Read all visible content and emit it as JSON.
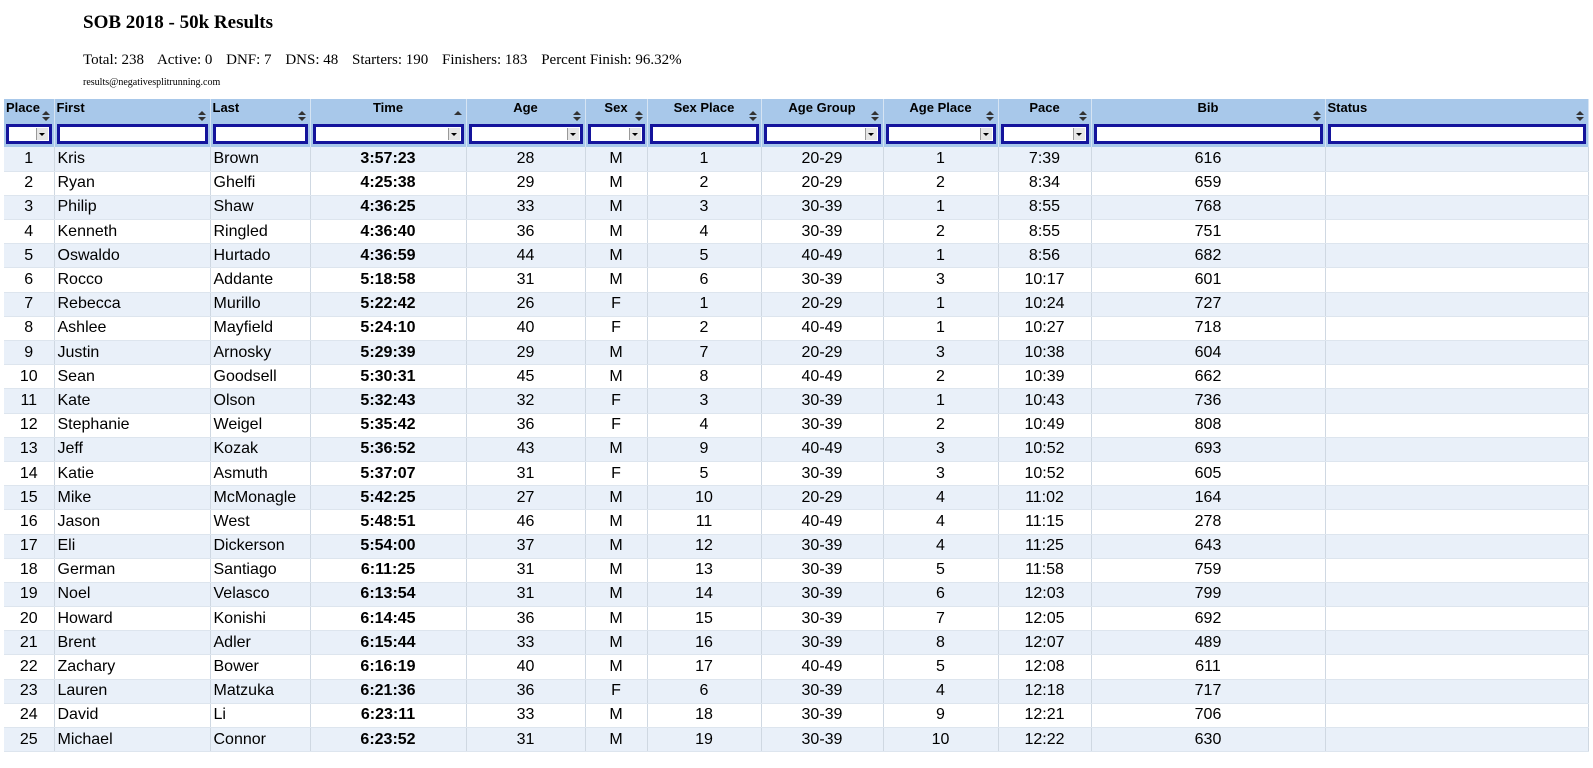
{
  "title": "SOB 2018 - 50k Results",
  "summary": {
    "total": "Total: 238",
    "active": "Active: 0",
    "dnf": "DNF: 7",
    "dns": "DNS: 48",
    "starters": "Starters: 190",
    "finishers": "Finishers: 183",
    "percent": "Percent Finish: 96.32%"
  },
  "contact": "results@negativesplitrunning.com",
  "columns": [
    "Place",
    "First",
    "Last",
    "Time",
    "Age",
    "Sex",
    "Sex Place",
    "Age Group",
    "Age Place",
    "Pace",
    "Bib",
    "Status"
  ],
  "rows": [
    [
      "1",
      "Kris",
      "Brown",
      "3:57:23",
      "28",
      "M",
      "1",
      "20-29",
      "1",
      "7:39",
      "616",
      ""
    ],
    [
      "2",
      "Ryan",
      "Ghelfi",
      "4:25:38",
      "29",
      "M",
      "2",
      "20-29",
      "2",
      "8:34",
      "659",
      ""
    ],
    [
      "3",
      "Philip",
      "Shaw",
      "4:36:25",
      "33",
      "M",
      "3",
      "30-39",
      "1",
      "8:55",
      "768",
      ""
    ],
    [
      "4",
      "Kenneth",
      "Ringled",
      "4:36:40",
      "36",
      "M",
      "4",
      "30-39",
      "2",
      "8:55",
      "751",
      ""
    ],
    [
      "5",
      "Oswaldo",
      "Hurtado",
      "4:36:59",
      "44",
      "M",
      "5",
      "40-49",
      "1",
      "8:56",
      "682",
      ""
    ],
    [
      "6",
      "Rocco",
      "Addante",
      "5:18:58",
      "31",
      "M",
      "6",
      "30-39",
      "3",
      "10:17",
      "601",
      ""
    ],
    [
      "7",
      "Rebecca",
      "Murillo",
      "5:22:42",
      "26",
      "F",
      "1",
      "20-29",
      "1",
      "10:24",
      "727",
      ""
    ],
    [
      "8",
      "Ashlee",
      "Mayfield",
      "5:24:10",
      "40",
      "F",
      "2",
      "40-49",
      "1",
      "10:27",
      "718",
      ""
    ],
    [
      "9",
      "Justin",
      "Arnosky",
      "5:29:39",
      "29",
      "M",
      "7",
      "20-29",
      "3",
      "10:38",
      "604",
      ""
    ],
    [
      "10",
      "Sean",
      "Goodsell",
      "5:30:31",
      "45",
      "M",
      "8",
      "40-49",
      "2",
      "10:39",
      "662",
      ""
    ],
    [
      "11",
      "Kate",
      "Olson",
      "5:32:43",
      "32",
      "F",
      "3",
      "30-39",
      "1",
      "10:43",
      "736",
      ""
    ],
    [
      "12",
      "Stephanie",
      "Weigel",
      "5:35:42",
      "36",
      "F",
      "4",
      "30-39",
      "2",
      "10:49",
      "808",
      ""
    ],
    [
      "13",
      "Jeff",
      "Kozak",
      "5:36:52",
      "43",
      "M",
      "9",
      "40-49",
      "3",
      "10:52",
      "693",
      ""
    ],
    [
      "14",
      "Katie",
      "Asmuth",
      "5:37:07",
      "31",
      "F",
      "5",
      "30-39",
      "3",
      "10:52",
      "605",
      ""
    ],
    [
      "15",
      "Mike",
      "McMonagle",
      "5:42:25",
      "27",
      "M",
      "10",
      "20-29",
      "4",
      "11:02",
      "164",
      ""
    ],
    [
      "16",
      "Jason",
      "West",
      "5:48:51",
      "46",
      "M",
      "11",
      "40-49",
      "4",
      "11:15",
      "278",
      ""
    ],
    [
      "17",
      "Eli",
      "Dickerson",
      "5:54:00",
      "37",
      "M",
      "12",
      "30-39",
      "4",
      "11:25",
      "643",
      ""
    ],
    [
      "18",
      "German",
      "Santiago",
      "6:11:25",
      "31",
      "M",
      "13",
      "30-39",
      "5",
      "11:58",
      "759",
      ""
    ],
    [
      "19",
      "Noel",
      "Velasco",
      "6:13:54",
      "31",
      "M",
      "14",
      "30-39",
      "6",
      "12:03",
      "799",
      ""
    ],
    [
      "20",
      "Howard",
      "Konishi",
      "6:14:45",
      "36",
      "M",
      "15",
      "30-39",
      "7",
      "12:05",
      "692",
      ""
    ],
    [
      "21",
      "Brent",
      "Adler",
      "6:15:44",
      "33",
      "M",
      "16",
      "30-39",
      "8",
      "12:07",
      "489",
      ""
    ],
    [
      "22",
      "Zachary",
      "Bower",
      "6:16:19",
      "40",
      "M",
      "17",
      "40-49",
      "5",
      "12:08",
      "611",
      ""
    ],
    [
      "23",
      "Lauren",
      "Matzuka",
      "6:21:36",
      "36",
      "F",
      "6",
      "30-39",
      "4",
      "12:18",
      "717",
      ""
    ],
    [
      "24",
      "David",
      "Li",
      "6:23:11",
      "33",
      "M",
      "18",
      "30-39",
      "9",
      "12:21",
      "706",
      ""
    ],
    [
      "25",
      "Michael",
      "Connor",
      "6:23:52",
      "31",
      "M",
      "19",
      "30-39",
      "10",
      "12:22",
      "630",
      ""
    ]
  ]
}
